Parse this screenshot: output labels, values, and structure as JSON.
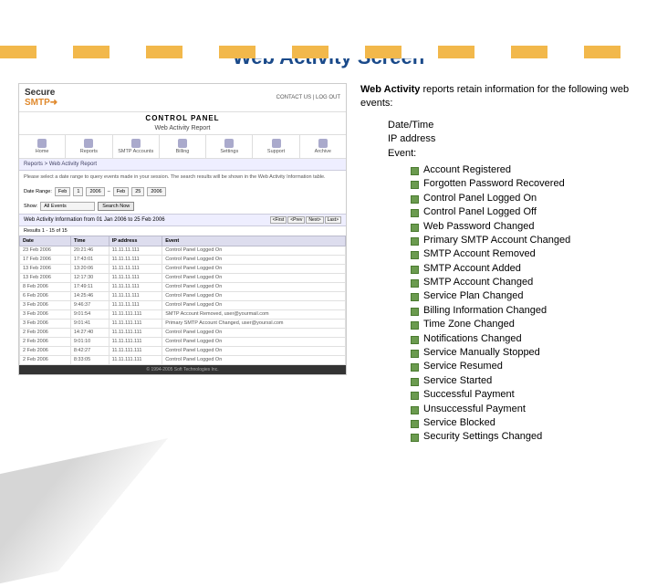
{
  "title": "Web Activity Screen",
  "intro_bold": "Web Activity",
  "intro_rest": " reports retain information for the following web events:",
  "fields": [
    "Date/Time",
    "IP address",
    "Event:"
  ],
  "events": [
    "Account Registered",
    "Forgotten Password Recovered",
    "Control Panel Logged On",
    "Control Panel Logged Off",
    "Web Password Changed",
    "Primary SMTP Account Changed",
    "SMTP Account Removed",
    "SMTP Account Added",
    "SMTP Account Changed",
    "Service Plan Changed",
    "Billing Information Changed",
    "Time Zone Changed",
    "Notifications Changed",
    "Service Manually Stopped",
    "Service Resumed",
    "Service Started",
    "Successful Payment",
    "Unsuccessful Payment",
    "Service Blocked",
    "Security Settings Changed"
  ],
  "panel": {
    "logo_a": "Secure",
    "logo_b": "SMTP",
    "links": "CONTACT US | LOG OUT",
    "cp": "CONTROL PANEL",
    "sub": "Web Activity Report",
    "tabs": [
      "Home",
      "Reports",
      "SMTP Accounts",
      "Billing",
      "Settings",
      "Support",
      "Archive"
    ],
    "crumbs": "Reports > Web Activity Report",
    "note": "Please select a date range to query events made in your session. The search results will be shown in the Web Activity Information table.",
    "filters": {
      "range_label": "Date Range:",
      "from_m": "Feb",
      "from_d": "1",
      "from_y": "2006",
      "to_m": "Feb",
      "to_d": "25",
      "to_y": "2006",
      "show_label": "Show:",
      "show_val": "All Events",
      "search": "Search Now"
    },
    "infohead": "Web Activity Information from 01 Jan 2006 to 25 Feb 2006",
    "results": "Results 1 - 15 of 15",
    "pager": [
      "<First",
      "<Prev",
      "Next>",
      "Last>"
    ],
    "cols": [
      "Date",
      "Time",
      "IP address",
      "Event"
    ],
    "rows": [
      [
        "23 Feb 2006",
        "20:21:46",
        "11.11.11.111",
        "Control Panel Logged On"
      ],
      [
        "17 Feb 2006",
        "17:43:01",
        "11.11.11.111",
        "Control Panel Logged On"
      ],
      [
        "13 Feb 2006",
        "13:20:06",
        "11.11.11.111",
        "Control Panel Logged On"
      ],
      [
        "13 Feb 2006",
        "12:17:30",
        "11.11.11.111",
        "Control Panel Logged On"
      ],
      [
        "8 Feb 2006",
        "17:49:11",
        "11.11.11.111",
        "Control Panel Logged On"
      ],
      [
        "6 Feb 2006",
        "14:25:46",
        "11.11.11.111",
        "Control Panel Logged On"
      ],
      [
        "3 Feb 2006",
        "9:46:37",
        "11.11.11.111",
        "Control Panel Logged On"
      ],
      [
        "3 Feb 2006",
        "9:01:54",
        "11.11.111.111",
        "SMTP Account Removed, user@yourmail.com"
      ],
      [
        "3 Feb 2006",
        "9:01:41",
        "11.11.111.111",
        "Primary SMTP Account Changed, user@yourssl.com"
      ],
      [
        "2 Feb 2006",
        "14:27:40",
        "11.11.111.111",
        "Control Panel Logged On"
      ],
      [
        "2 Feb 2006",
        "9:01:10",
        "11.11.111.111",
        "Control Panel Logged On"
      ],
      [
        "2 Feb 2006",
        "8:42:27",
        "11.11.111.111",
        "Control Panel Logged On"
      ],
      [
        "2 Feb 2006",
        "8:33:05",
        "11.11.111.111",
        "Control Panel Logged On"
      ]
    ],
    "foot": "© 1994-2005 Soft Technologies Inc."
  }
}
